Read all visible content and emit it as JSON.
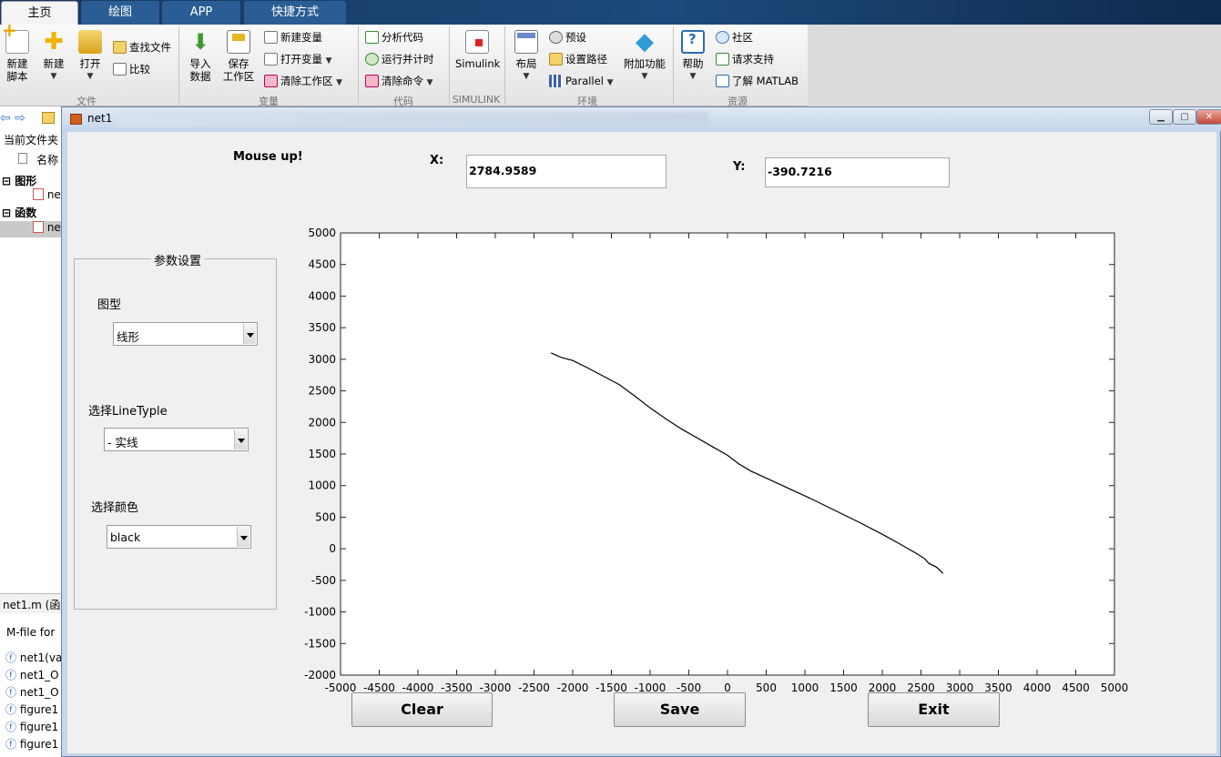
{
  "matlab": {
    "tabs": [
      "主页",
      "绘图",
      "APP",
      "快捷方式"
    ],
    "ribbon": {
      "file": {
        "group": "文件",
        "new_script": [
          "新建",
          "脚本"
        ],
        "new": "新建",
        "open": "打开",
        "find_files": "查找文件",
        "compare": "比较"
      },
      "variable": {
        "group": "变量",
        "import": [
          "导入",
          "数据"
        ],
        "save_ws": [
          "保存",
          "工作区"
        ],
        "new_var": "新建变量",
        "open_var": "打开变量",
        "clear_ws": "清除工作区"
      },
      "code": {
        "group": "代码",
        "analyze": "分析代码",
        "run_time": "运行并计时",
        "clear_cmd": "清除命令"
      },
      "simulink": {
        "group": "SIMULINK",
        "label": "Simulink"
      },
      "env": {
        "group": "环境",
        "layout": "布局",
        "prefs": "预设",
        "set_path": "设置路径",
        "parallel": "Parallel",
        "addons": "附加功能"
      },
      "resources": {
        "group": "资源",
        "help": "帮助",
        "community": "社区",
        "support": "请求支持",
        "learn": "了解 MATLAB"
      }
    },
    "left_panel": {
      "title": "当前文件夹",
      "col_name": "名称",
      "node_figures": "图形",
      "node_funcs": "函数",
      "file_trunc": "ne",
      "details_file": "net1.m",
      "details_type": "(函",
      "details_desc": "M-file for",
      "funcs": [
        "net1(va",
        "net1_O",
        "net1_O",
        "figure1",
        "figure1",
        "figure1"
      ]
    }
  },
  "figure": {
    "title": "net1",
    "status_text": "Mouse up!",
    "x_label": "X:",
    "x_value": "2784.9589",
    "y_label": "Y:",
    "y_value": "-390.7216",
    "panel": {
      "title": "参数设置",
      "graph_type_label": "图型",
      "graph_type_value": "线形",
      "linetype_label": "选择LineTyple",
      "linetype_value": "- 实线",
      "color_label": "选择颜色",
      "color_value": "black"
    },
    "buttons": {
      "clear": "Clear",
      "save": "Save",
      "exit": "Exit"
    }
  },
  "chart_data": {
    "type": "line",
    "xlim": [
      -5000,
      5000
    ],
    "ylim": [
      -2000,
      5000
    ],
    "xticks": [
      -5000,
      -4500,
      -4000,
      -3500,
      -3000,
      -2500,
      -2000,
      -1500,
      -1000,
      -500,
      0,
      500,
      1000,
      1500,
      2000,
      2500,
      3000,
      3500,
      4000,
      4500,
      5000
    ],
    "yticks": [
      -2000,
      -1500,
      -1000,
      -500,
      0,
      500,
      1000,
      1500,
      2000,
      2500,
      3000,
      3500,
      4000,
      4500,
      5000
    ],
    "grid": false,
    "line_color": "#000000",
    "series": [
      {
        "x": [
          -2280,
          -2150,
          -2000,
          -1800,
          -1600,
          -1400,
          -1200,
          -1000,
          -800,
          -600,
          -400,
          -200,
          0,
          150,
          300,
          500,
          800,
          1100,
          1400,
          1700,
          2000,
          2250,
          2450,
          2550,
          2600,
          2700,
          2785
        ],
        "y": [
          3100,
          3030,
          2980,
          2860,
          2730,
          2600,
          2420,
          2230,
          2060,
          1900,
          1760,
          1620,
          1480,
          1340,
          1230,
          1120,
          950,
          780,
          600,
          420,
          230,
          60,
          -80,
          -160,
          -230,
          -290,
          -390
        ]
      }
    ]
  }
}
